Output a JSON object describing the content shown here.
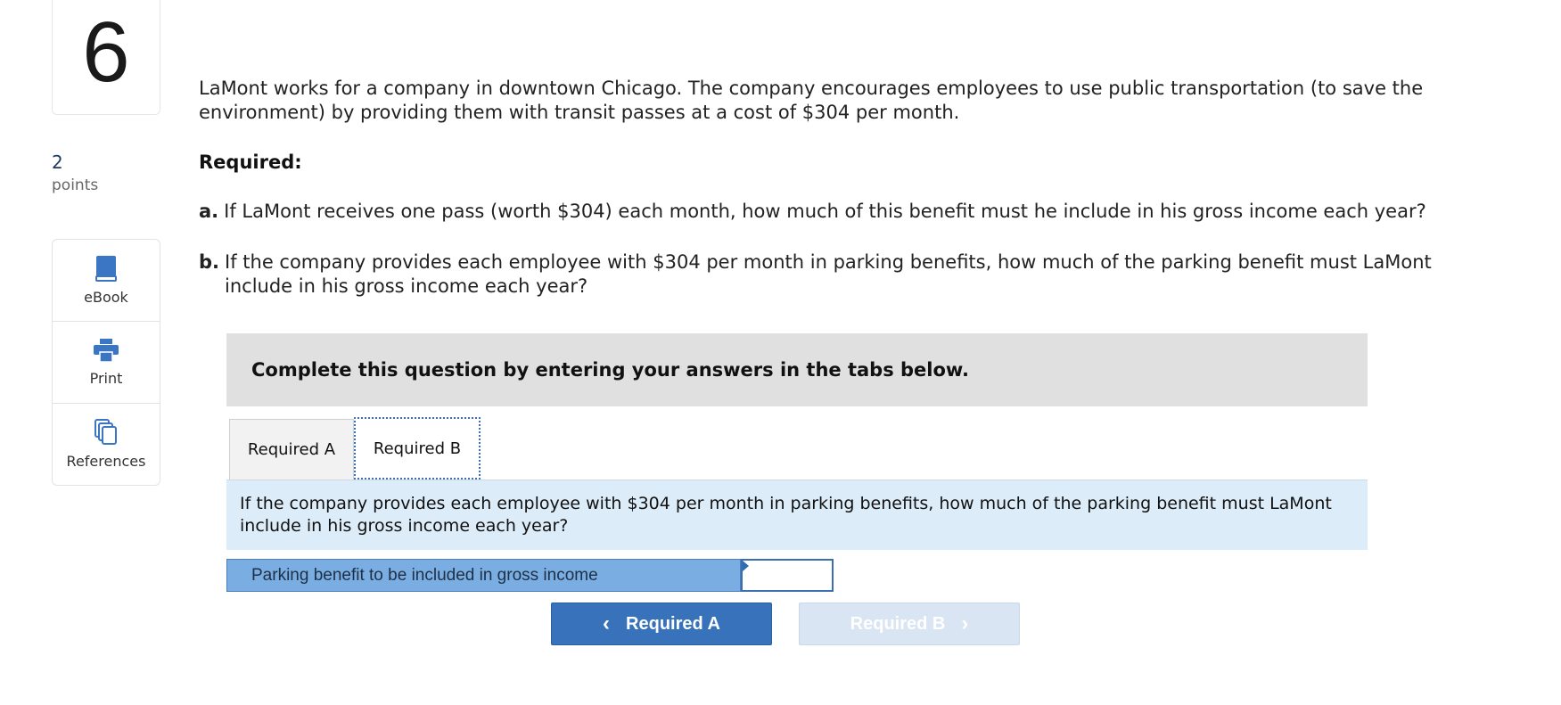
{
  "question": {
    "number": "6",
    "points_value": "2",
    "points_label": "points"
  },
  "tools": [
    {
      "label": "eBook",
      "icon": "book-icon"
    },
    {
      "label": "Print",
      "icon": "printer-icon"
    },
    {
      "label": "References",
      "icon": "documents-icon"
    }
  ],
  "content": {
    "intro": "LaMont works for a company in downtown Chicago. The company encourages employees to use public transportation (to save the environment) by providing them with transit passes at a cost of $304 per month.",
    "required_heading": "Required:",
    "part_a_label": "a.",
    "part_a_text": "If LaMont receives one pass (worth $304) each month, how much of this benefit must he include in his gross income each year?",
    "part_b_label": "b.",
    "part_b_text": "If the company provides each employee with $304 per month in parking benefits, how much of the parking benefit must LaMont include in his gross income each year?"
  },
  "panel": {
    "instruction": "Complete this question by entering your answers in the tabs below.",
    "tabs": [
      {
        "label": "Required A",
        "active": false
      },
      {
        "label": "Required B",
        "active": true
      }
    ],
    "question_text": "If the company provides each employee with $304 per month in parking benefits, how much of the parking benefit must LaMont include in his gross income each year?",
    "answer_label": "Parking benefit to be included in gross income",
    "answer_value": ""
  },
  "navigation": {
    "prev_label": "Required A",
    "next_label": "Required B",
    "prev_enabled": true,
    "next_enabled": false
  },
  "colors": {
    "accent": "#3772ba",
    "question_bg": "#dcecf9",
    "answer_label_bg": "#7aaee3",
    "instruction_bg": "#e0e0e0"
  }
}
